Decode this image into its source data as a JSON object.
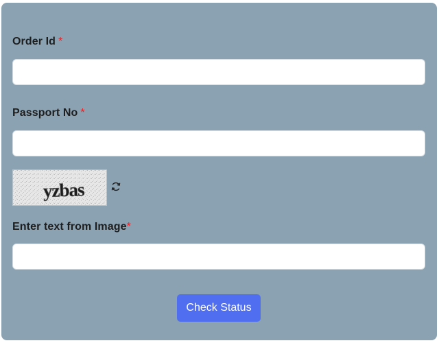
{
  "form": {
    "order_id": {
      "label": "Order Id",
      "required_mark": "*",
      "value": "",
      "placeholder": ""
    },
    "passport_no": {
      "label": "Passport No",
      "required_mark": "*",
      "value": "",
      "placeholder": ""
    },
    "captcha": {
      "image_text": "yzbas",
      "refresh_icon": "refresh-icon"
    },
    "captcha_input": {
      "label": "Enter text from Image",
      "required_mark": "*",
      "value": "",
      "placeholder": ""
    },
    "submit": {
      "label": "Check Status"
    }
  },
  "colors": {
    "panel_bg": "#8ba2b2",
    "required": "#d9262b",
    "button_bg": "#4f6ff0",
    "button_text": "#ffffff"
  }
}
